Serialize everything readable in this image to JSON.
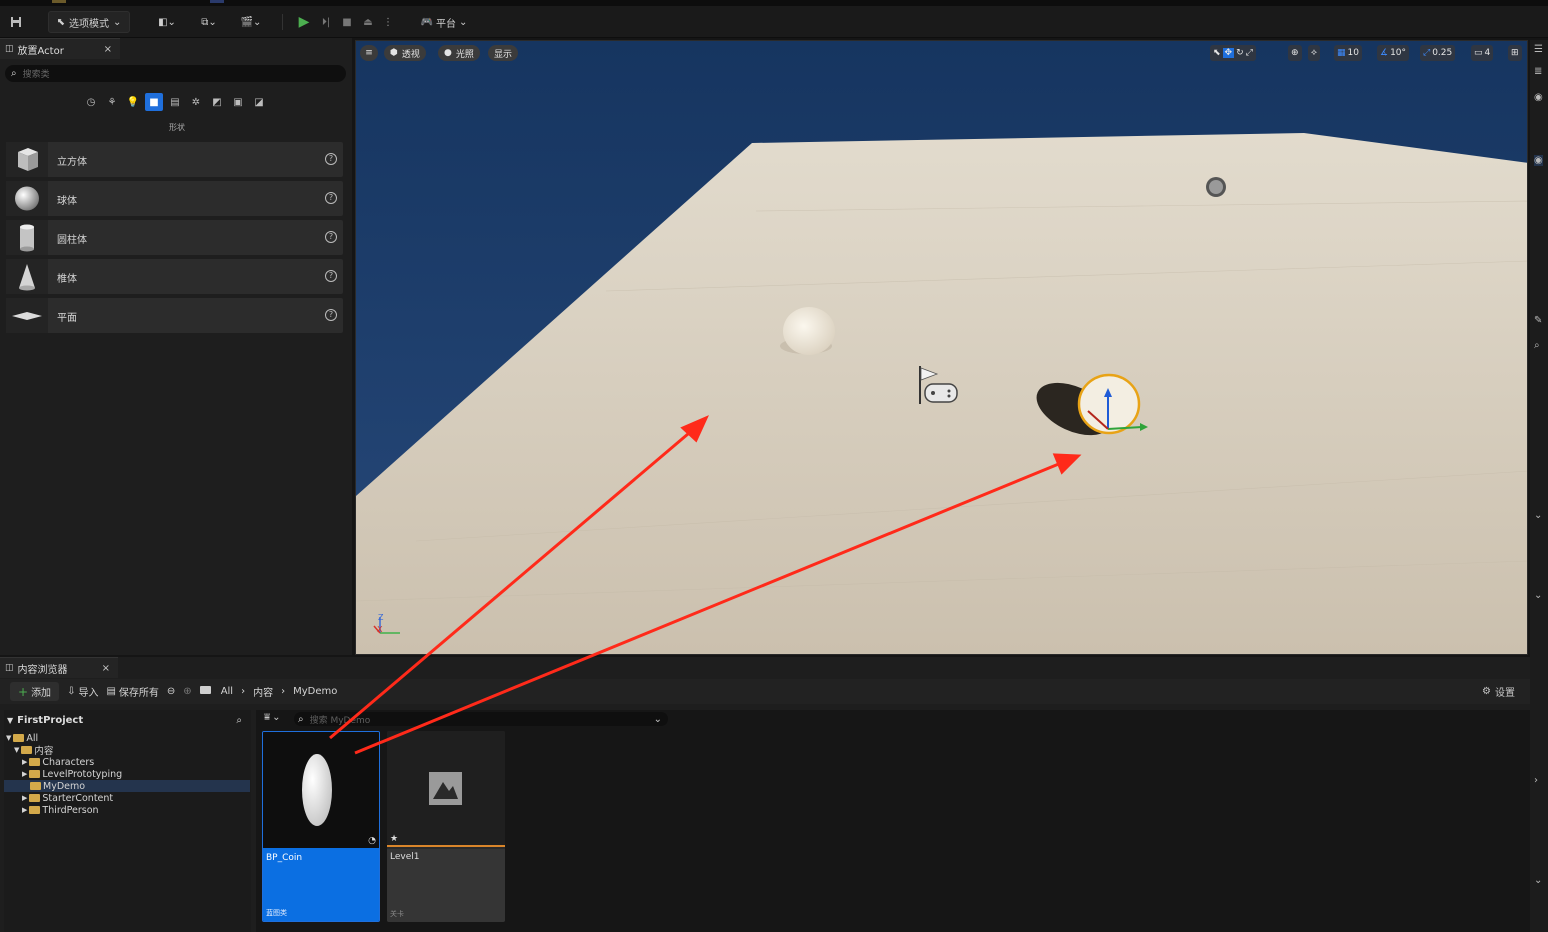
{
  "toolbar": {
    "mode_label": "选项模式",
    "platform_label": "平台"
  },
  "place_actor": {
    "tab_title": "放置Actor",
    "search_placeholder": "搜索类",
    "category_label": "形状",
    "items": [
      {
        "label": "立方体"
      },
      {
        "label": "球体"
      },
      {
        "label": "圆柱体"
      },
      {
        "label": "椎体"
      },
      {
        "label": "平面"
      }
    ]
  },
  "viewport": {
    "view_mode": "透视",
    "lighting": "光照",
    "show": "显示",
    "grid_snap": "10",
    "rotation_snap": "10°",
    "scale_snap": "0.25",
    "camera_speed": "4"
  },
  "content_browser": {
    "tab_title": "内容浏览器",
    "add_label": "添加",
    "import_label": "导入",
    "save_all_label": "保存所有",
    "breadcrumb": [
      "All",
      "内容",
      "MyDemo"
    ],
    "settings_label": "设置",
    "project_name": "FirstProject",
    "search_placeholder": "搜索 MyDemo",
    "tree": [
      {
        "label": "All",
        "depth": 0
      },
      {
        "label": "内容",
        "depth": 1
      },
      {
        "label": "Characters",
        "depth": 2
      },
      {
        "label": "LevelPrototyping",
        "depth": 2
      },
      {
        "label": "MyDemo",
        "depth": 2,
        "selected": true
      },
      {
        "label": "StarterContent",
        "depth": 2
      },
      {
        "label": "ThirdPerson",
        "depth": 2
      }
    ],
    "assets": [
      {
        "name": "BP_Coin",
        "type": "蓝图类",
        "selected": true
      },
      {
        "name": "Level1",
        "type": "关卡",
        "selected": false
      }
    ]
  },
  "colors": {
    "accent": "#1f6fdc",
    "arrow": "#ff2a1a",
    "sky": "#1b3a66",
    "floor": "#cfc6b6"
  }
}
